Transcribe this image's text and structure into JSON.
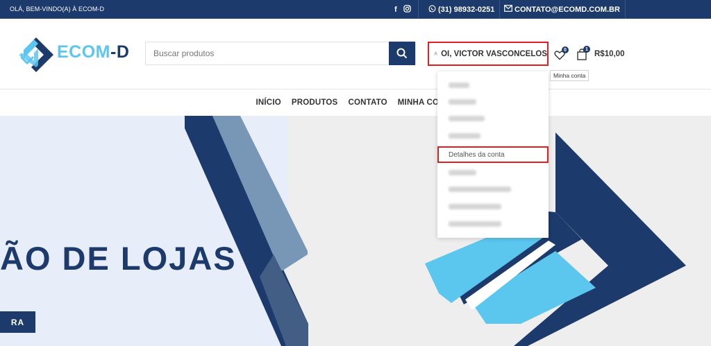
{
  "topbar": {
    "welcome": "OLÁ, BEM-VINDO(A) À ECOM-D",
    "social_icons": [
      "facebook-icon",
      "instagram-icon"
    ],
    "phone": "(31) 98932-0251",
    "email": "CONTATO@ECOMD.COM.BR"
  },
  "logo": {
    "part1": "ECOM",
    "part2": "-D"
  },
  "search": {
    "placeholder": "Buscar produtos",
    "icon": "search-icon"
  },
  "account": {
    "label": "OI, VICTOR VASCONCELOS",
    "icon": "user-icon",
    "tooltip": "Minha conta"
  },
  "wishlist": {
    "icon": "heart-icon",
    "count": "0"
  },
  "cart": {
    "icon": "shopping-bag-icon",
    "count": "1",
    "total": "R$10,00"
  },
  "nav": {
    "items": [
      "INÍCIO",
      "PRODUTOS",
      "CONTATO",
      "MINHA CONTA"
    ]
  },
  "dropdown": {
    "highlighted_item": "Detalhes da conta"
  },
  "hero": {
    "title": "ÃO DE LOJAS",
    "button": "RA"
  },
  "colors": {
    "brand_dark": "#1c3a6b",
    "brand_light": "#5bc6ee",
    "highlight_red": "#e02020"
  }
}
